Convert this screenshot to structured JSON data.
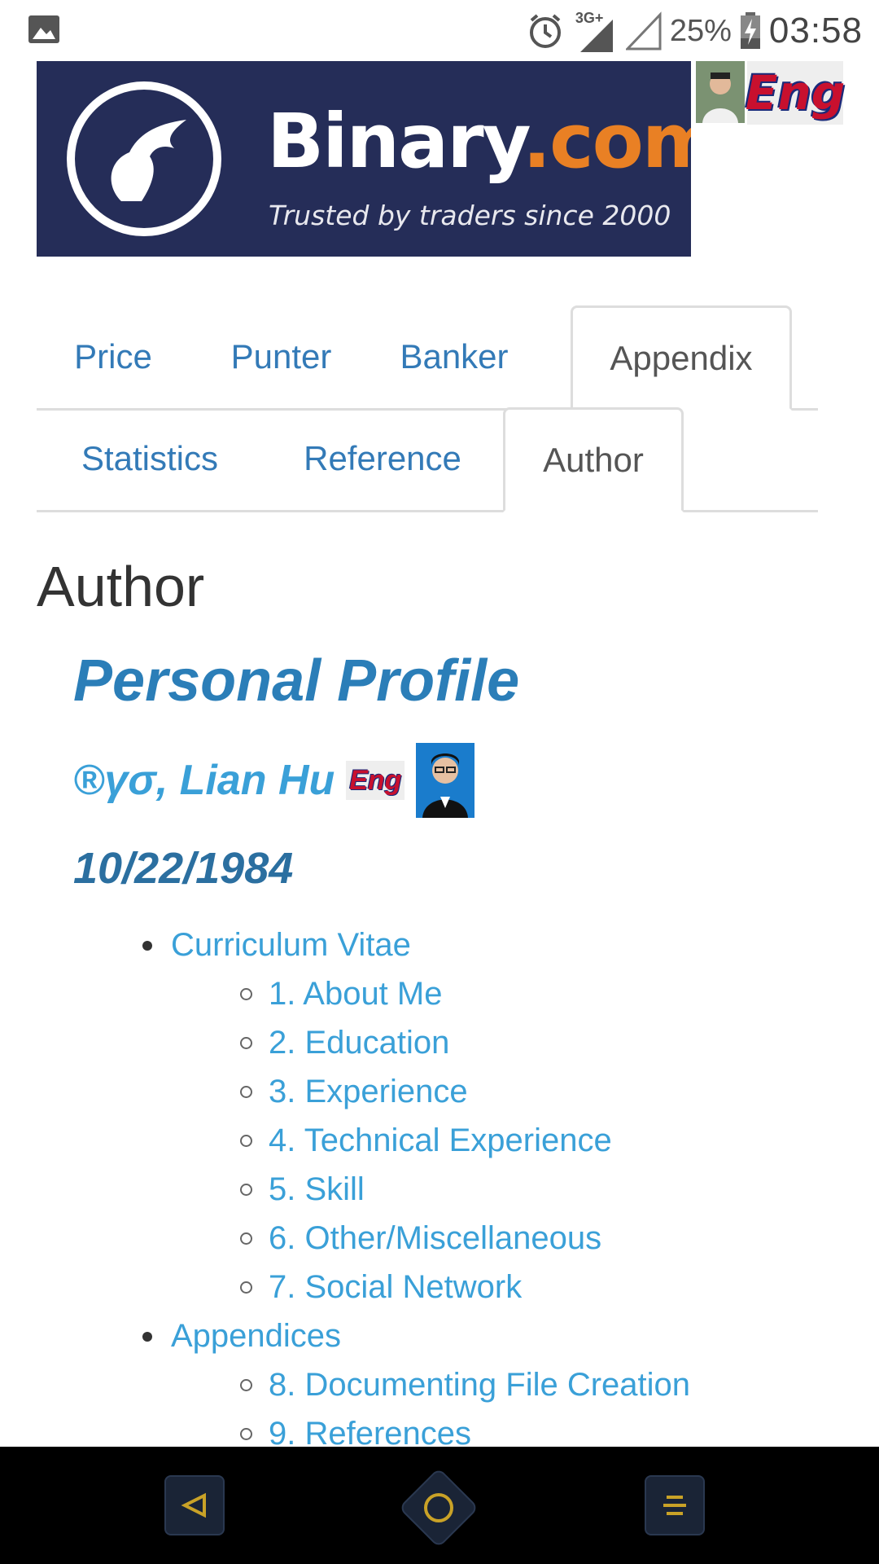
{
  "status_bar": {
    "network": "3G+",
    "battery": "25%",
    "time": "03:58"
  },
  "banner": {
    "brand_main": "Binary",
    "brand_suffix": ".com",
    "tagline": "Trusted by traders since 2000"
  },
  "language_badge": "Eng",
  "tabs": {
    "row1": [
      {
        "label": "Price",
        "active": false
      },
      {
        "label": "Punter",
        "active": false
      },
      {
        "label": "Banker",
        "active": false
      },
      {
        "label": "Appendix",
        "active": true
      }
    ],
    "row2": [
      {
        "label": "Statistics",
        "active": false
      },
      {
        "label": "Reference",
        "active": false
      },
      {
        "label": "Author",
        "active": true
      }
    ]
  },
  "content": {
    "heading": "Author",
    "profile_title": "Personal Profile",
    "name": "®γσ, Lian Hu",
    "date": "10/22/1984",
    "toc": [
      {
        "label": "Curriculum Vitae",
        "children": [
          "1. About Me",
          "2. Education",
          "3. Experience",
          "4. Technical Experience",
          "5. Skill",
          "6. Other/Miscellaneous",
          "7. Social Network"
        ]
      },
      {
        "label": "Appendices",
        "children": [
          "8. Documenting File Creation",
          "9. References"
        ]
      }
    ]
  },
  "colors": {
    "link": "#3aa0d8",
    "banner_bg": "#252d58",
    "brand_accent": "#e98024"
  }
}
